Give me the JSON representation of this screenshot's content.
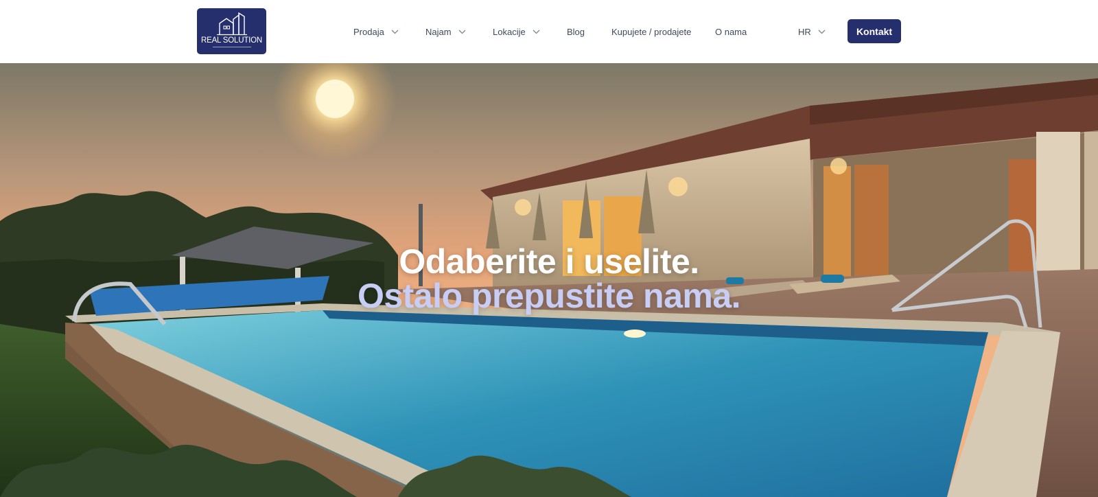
{
  "logo": {
    "text": "REAL SOLUTION",
    "tagline": "nekretnine"
  },
  "nav": {
    "items": [
      {
        "label": "Prodaja",
        "has_dropdown": true
      },
      {
        "label": "Najam",
        "has_dropdown": true
      },
      {
        "label": "Lokacije",
        "has_dropdown": true
      },
      {
        "label": "Blog",
        "has_dropdown": false
      },
      {
        "label": "Kupujete / prodajete",
        "has_dropdown": false
      },
      {
        "label": "O nama",
        "has_dropdown": false
      }
    ],
    "language": "HR",
    "contact_label": "Kontakt"
  },
  "hero": {
    "line1": "Odaberite i uselite.",
    "line2": "Ostalo prepustite nama.",
    "image": "villa-with-pool-at-sunset"
  },
  "colors": {
    "brand": "#262f6e",
    "nav_text": "#3d4a5c",
    "hero_line1": "#ffffff",
    "hero_line2": "#c8cdf6"
  },
  "icons": {
    "dropdown": "chevron-down-icon",
    "logo_mark": "buildings-icon"
  }
}
